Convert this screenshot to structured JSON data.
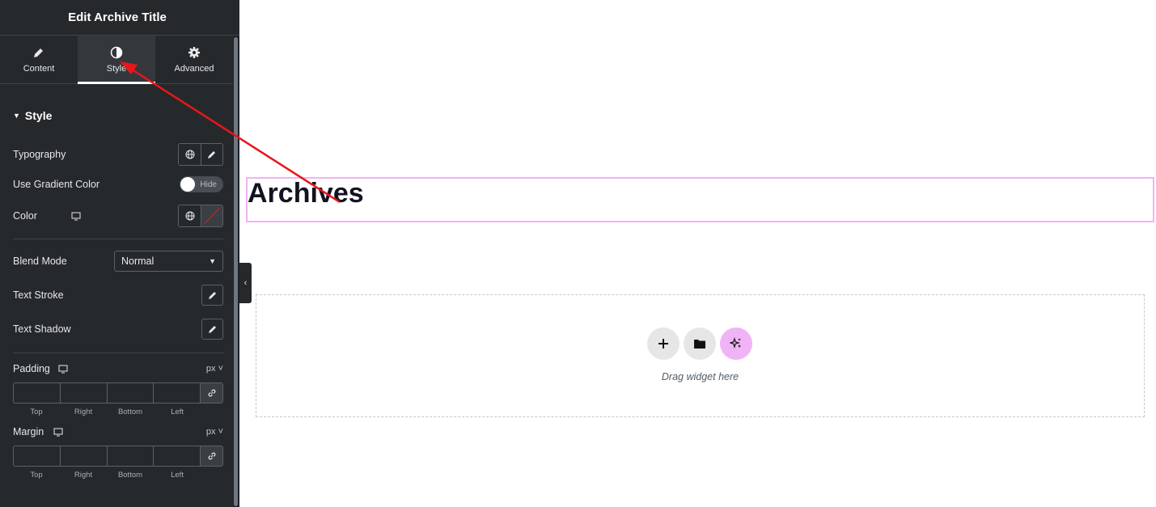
{
  "panel": {
    "title": "Edit Archive Title",
    "tabs": [
      {
        "label": "Content",
        "icon": "pencil-icon"
      },
      {
        "label": "Style",
        "icon": "half-circle-icon",
        "active": true
      },
      {
        "label": "Advanced",
        "icon": "gear-icon"
      }
    ],
    "section_title": "Style",
    "typography_label": "Typography",
    "gradient_label": "Use Gradient Color",
    "gradient_toggle": "Hide",
    "color_label": "Color",
    "blend_label": "Blend Mode",
    "blend_value": "Normal",
    "text_stroke_label": "Text Stroke",
    "text_shadow_label": "Text Shadow",
    "padding_label": "Padding",
    "padding_unit": "px",
    "margin_label": "Margin",
    "margin_unit": "px",
    "dimension_labels": [
      "Top",
      "Right",
      "Bottom",
      "Left"
    ]
  },
  "canvas": {
    "archive_title": "Archives",
    "drag_text": "Drag widget here"
  },
  "colors": {
    "panel_bg": "#26292c",
    "highlight_border": "#f0b3f5",
    "ai_button": "#f0b3f5",
    "arrow": "#e8161b"
  }
}
